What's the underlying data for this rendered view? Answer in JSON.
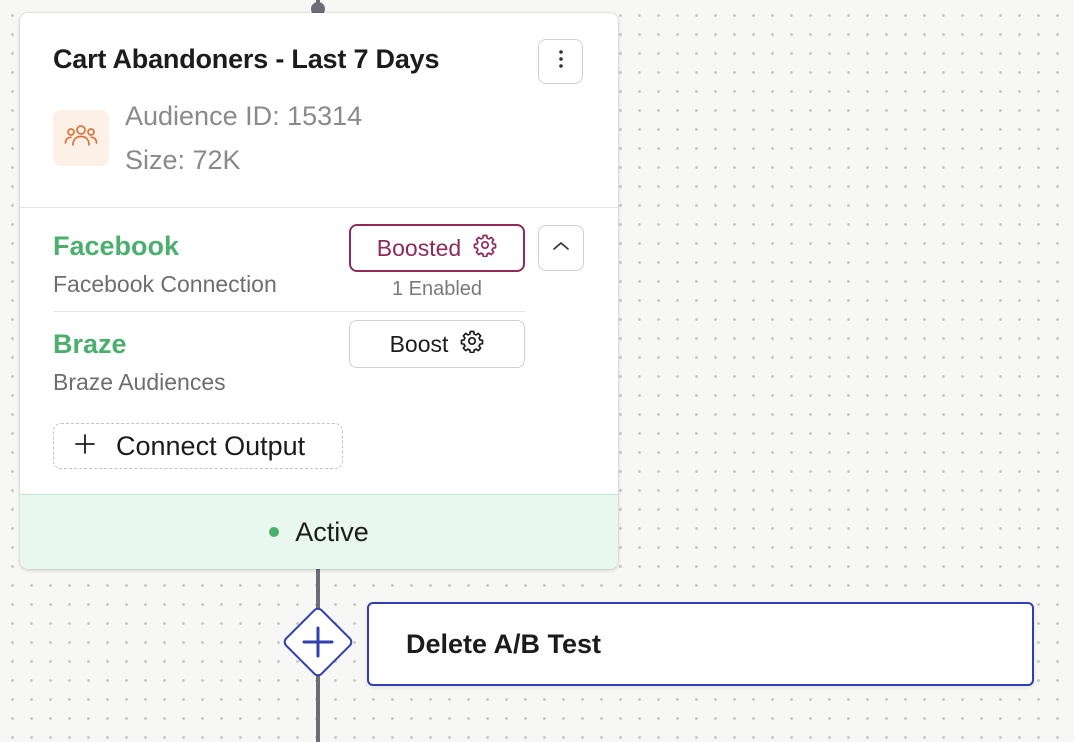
{
  "card": {
    "title": "Cart Abandoners - Last 7 Days",
    "audience_id": "Audience ID: 15314",
    "size": "Size: 72K",
    "icon": "users-icon",
    "menu_icon": "more-vertical-icon"
  },
  "outputs": [
    {
      "name": "Facebook",
      "subtitle": "Facebook Connection",
      "button_label": "Boosted",
      "button_icon": "gear-icon",
      "enabled_text": "1 Enabled"
    },
    {
      "name": "Braze",
      "subtitle": "Braze Audiences",
      "button_label": "Boost",
      "button_icon": "gear-icon"
    }
  ],
  "collapse_icon": "chevron-up-icon",
  "connect_output": {
    "label": "Connect Output",
    "icon": "plus-icon"
  },
  "status": {
    "label": "Active",
    "color": "#4caf6d"
  },
  "flow": {
    "add_icon": "plus-icon",
    "delete_ab_test_label": "Delete A/B Test"
  },
  "colors": {
    "success": "#4caf6d",
    "boosted": "#8e2a5c",
    "accent": "#2f3fb0",
    "status_bg": "#e9f8ee",
    "icon_bg": "#fdf0e6",
    "icon_stroke": "#d9743b"
  }
}
